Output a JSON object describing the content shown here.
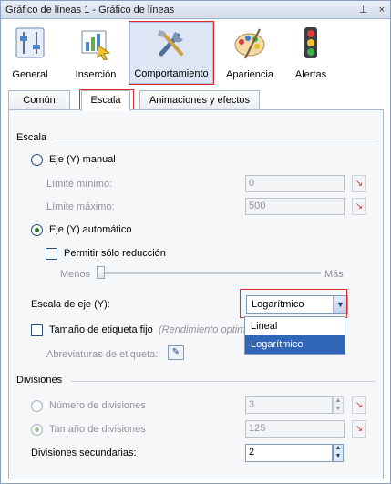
{
  "window": {
    "title": "Gráfico de líneas 1 - Gráfico de líneas",
    "pin_glyph": "⊥",
    "close_glyph": "×"
  },
  "ribbon": {
    "items": [
      {
        "label": "General",
        "icon": "properties-sliders-icon"
      },
      {
        "label": "Inserción",
        "icon": "chart-insert-icon"
      },
      {
        "label": "Comportamiento",
        "icon": "tools-icon",
        "active": true
      },
      {
        "label": "Apariencia",
        "icon": "palette-icon"
      },
      {
        "label": "Alertas",
        "icon": "traffic-light-icon"
      }
    ]
  },
  "tabs": [
    {
      "label": "Común"
    },
    {
      "label": "Escala",
      "selected": true
    },
    {
      "label": "Animaciones y efectos"
    }
  ],
  "scale": {
    "section_title": "Escala",
    "manual_label": "Eje (Y) manual",
    "min_label": "Límite mínimo:",
    "min_value": "0",
    "max_label": "Límite máximo:",
    "max_value": "500",
    "auto_label": "Eje (Y) automático",
    "reduction_label": "Permitir sólo reducción",
    "slider_min_label": "Menos",
    "slider_max_label": "Más",
    "slider_level": 0
  },
  "axis_scale": {
    "label": "Escala de eje (Y):",
    "selected": "Logarítmico",
    "options": [
      "Lineal",
      "Logarítmico"
    ]
  },
  "label_size": {
    "fixed_label": "Tamaño de etiqueta fijo",
    "hint": "(Rendimiento optimi",
    "abbr_label": "Abreviaturas de etiqueta:"
  },
  "divisions": {
    "section_title": "Divisiones",
    "count_label": "Número de divisiones",
    "count_value": "3",
    "size_label": "Tamaño de divisiones",
    "size_value": "125",
    "secondary_label": "Divisiones secundarias:",
    "secondary_value": "2"
  },
  "glyphs": {
    "pick": "↘",
    "spin_up": "▲",
    "spin_down": "▼",
    "combo_arrow": "▼",
    "abbr": "✎"
  },
  "colors": {
    "highlight_box": "#e02b2b",
    "dropdown_selection": "#3066b8"
  }
}
